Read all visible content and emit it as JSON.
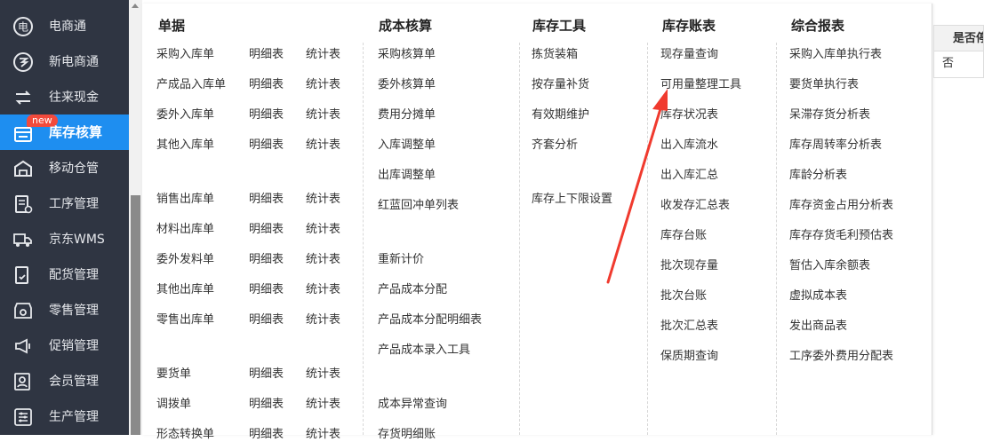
{
  "sidebar": {
    "items": [
      {
        "label": "电商通",
        "icon": "ecommerce-icon"
      },
      {
        "label": "新电商通",
        "icon": "new-ecommerce-icon"
      },
      {
        "label": "往来现金",
        "icon": "cash-transfer-icon"
      },
      {
        "label": "库存核算",
        "icon": "inventory-icon",
        "active": true,
        "badge": "new"
      },
      {
        "label": "移动仓管",
        "icon": "mobile-warehouse-icon"
      },
      {
        "label": "工序管理",
        "icon": "process-icon"
      },
      {
        "label": "京东WMS",
        "icon": "truck-icon"
      },
      {
        "label": "配货管理",
        "icon": "distribution-icon"
      },
      {
        "label": "零售管理",
        "icon": "retail-icon"
      },
      {
        "label": "促销管理",
        "icon": "megaphone-icon"
      },
      {
        "label": "会员管理",
        "icon": "member-icon"
      },
      {
        "label": "生产管理",
        "icon": "production-icon"
      }
    ]
  },
  "menu": {
    "documents": {
      "title": "单据",
      "detail_label": "明细表",
      "stats_label": "统计表",
      "rows": [
        "采购入库单",
        "产成品入库单",
        "委外入库单",
        "其他入库单",
        "销售出库单",
        "材料出库单",
        "委外发料单",
        "其他出库单",
        "零售出库单",
        "要货单",
        "调拨单",
        "形态转换单"
      ]
    },
    "cost": {
      "title": "成本核算",
      "items": [
        "采购核算单",
        "委外核算单",
        "费用分摊单",
        "入库调整单",
        "出库调整单",
        "红蓝回冲单列表",
        "重新计价",
        "产品成本分配",
        "产品成本分配明细表",
        "产品成本录入工具",
        "成本异常查询",
        "存货明细账"
      ]
    },
    "tools": {
      "title": "库存工具",
      "items": [
        "拣货装箱",
        "按存量补货",
        "有效期维护",
        "齐套分析",
        "库存上下限设置"
      ]
    },
    "ledger": {
      "title": "库存账表",
      "items": [
        "现存量查询",
        "可用量整理工具",
        "库存状况表",
        "出入库流水",
        "出入库汇总",
        "收发存汇总表",
        "库存台账",
        "批次现存量",
        "批次台账",
        "批次汇总表",
        "保质期查询"
      ]
    },
    "reports": {
      "title": "综合报表",
      "items": [
        "采购入库单执行表",
        "要货单执行表",
        "呆滞存货分析表",
        "库存周转率分析表",
        "库龄分析表",
        "库存资金占用分析表",
        "库存存货毛利预估表",
        "暂估入库余额表",
        "虚拟成本表",
        "发出商品表",
        "工序委外费用分配表"
      ]
    }
  },
  "table": {
    "header": "是否停",
    "cell": "否"
  },
  "annotation": {
    "color": "#f03a2e"
  },
  "colors": {
    "sidebar_bg": "#2f3542",
    "active_bg": "#1e8ef0",
    "badge": "#f24a3c"
  }
}
